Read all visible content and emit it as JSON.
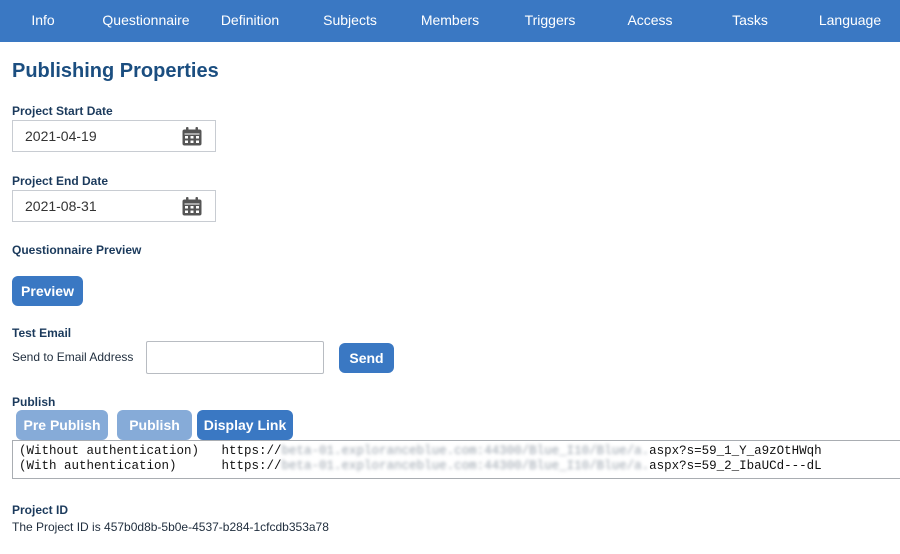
{
  "nav": {
    "items": [
      {
        "label": "Info"
      },
      {
        "label": "Questionnaire"
      },
      {
        "label": "Definition"
      },
      {
        "label": "Subjects"
      },
      {
        "label": "Members"
      },
      {
        "label": "Triggers"
      },
      {
        "label": "Access"
      },
      {
        "label": "Tasks"
      },
      {
        "label": "Language"
      }
    ]
  },
  "page": {
    "title": "Publishing Properties"
  },
  "start_date": {
    "label": "Project Start Date",
    "value": "2021-04-19",
    "icon": "calendar-icon"
  },
  "end_date": {
    "label": "Project End Date",
    "value": "2021-08-31",
    "icon": "calendar-icon"
  },
  "preview": {
    "label": "Questionnaire Preview",
    "button": "Preview"
  },
  "test_email": {
    "label": "Test Email",
    "field_label": "Send to Email Address",
    "value": "",
    "placeholder": "",
    "send_button": "Send"
  },
  "publish": {
    "label": "Publish",
    "pre_publish_button": "Pre Publish",
    "publish_button": "Publish",
    "display_link_button": "Display Link",
    "links": [
      {
        "prefix": "(Without authentication)   https://",
        "hidden": "beta-01.exploranceblue.com:44300/Blue_I10/Blue/a.",
        "suffix": "aspx?s=59_1_Y_a9zOtHWqh"
      },
      {
        "prefix": "(With authentication)      https://",
        "hidden": "beta-01.exploranceblue.com:44300/Blue_I10/Blue/a.",
        "suffix": "aspx?s=59_2_IbaUCd---dL"
      }
    ]
  },
  "project_id": {
    "label": "Project ID",
    "text": "The Project ID is 457b0d8b-5b0e-4537-b284-1cfcdb353a78"
  },
  "colors": {
    "accent": "#3a78c3",
    "accent_disabled": "#86abd8",
    "title": "#1b4e80"
  }
}
